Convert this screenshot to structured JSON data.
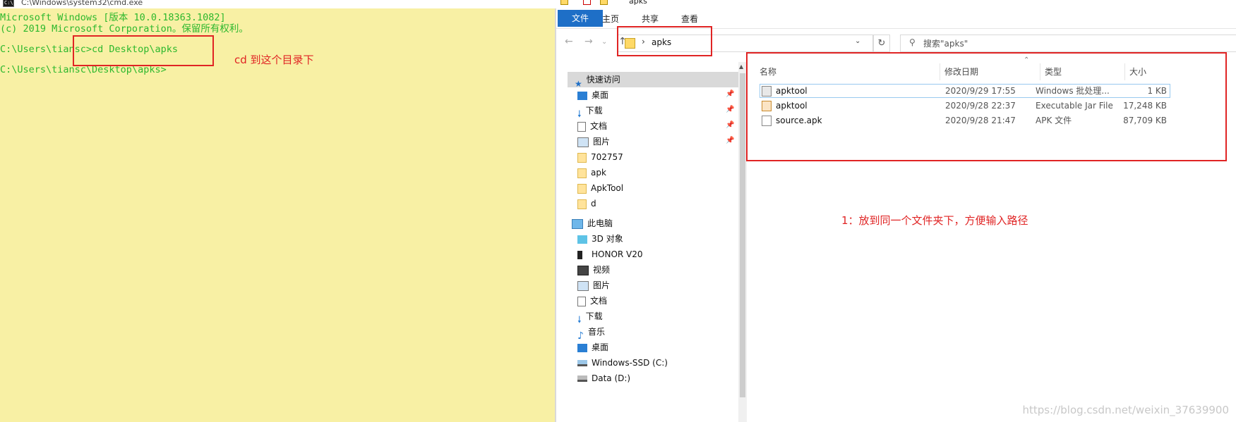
{
  "cmd": {
    "title": "C:\\Windows\\system32\\cmd.exe",
    "lines": [
      "Microsoft Windows [版本 10.0.18363.1082]",
      "(c) 2019 Microsoft Corporation。保留所有权利。",
      "",
      "C:\\Users\\tiansc>cd Desktop\\apks",
      "",
      "C:\\Users\\tiansc\\Desktop\\apks>"
    ],
    "text_color": "#2db82d",
    "background": "#f8f0a4"
  },
  "explorer": {
    "window_title": "apks",
    "ribbon_tabs": [
      "文件",
      "主页",
      "共享",
      "查看"
    ],
    "address": {
      "path": "apks",
      "separator": "›"
    },
    "search_placeholder": "搜索\"apks\"",
    "nav_buttons": {
      "back": "←",
      "forward": "→",
      "recent": "⌄",
      "up": "↑",
      "refresh": "↻"
    },
    "navpane": {
      "quick_access": "快速访问",
      "items": [
        {
          "label": "桌面",
          "icon": "desktop-icon",
          "pinned": true
        },
        {
          "label": "下载",
          "icon": "download-icon",
          "pinned": true
        },
        {
          "label": "文档",
          "icon": "document-icon",
          "pinned": true
        },
        {
          "label": "图片",
          "icon": "picture-icon",
          "pinned": true
        },
        {
          "label": "702757",
          "icon": "folder-icon",
          "pinned": false
        },
        {
          "label": "apk",
          "icon": "folder-icon",
          "pinned": false
        },
        {
          "label": "ApkTool",
          "icon": "folder-icon",
          "pinned": false
        },
        {
          "label": "d",
          "icon": "folder-icon",
          "pinned": false
        }
      ],
      "this_pc": "此电脑",
      "pc_items": [
        {
          "label": "3D 对象",
          "icon": "3d-objects-icon"
        },
        {
          "label": "HONOR V20",
          "icon": "phone-icon"
        },
        {
          "label": "视频",
          "icon": "video-icon"
        },
        {
          "label": "图片",
          "icon": "picture-icon"
        },
        {
          "label": "文档",
          "icon": "document-icon"
        },
        {
          "label": "下载",
          "icon": "download-icon"
        },
        {
          "label": "音乐",
          "icon": "music-icon"
        },
        {
          "label": "桌面",
          "icon": "desktop-icon"
        },
        {
          "label": "Windows-SSD (C:)",
          "icon": "drive-c-icon"
        },
        {
          "label": "Data (D:)",
          "icon": "drive-icon"
        }
      ]
    },
    "columns": [
      "名称",
      "修改日期",
      "类型",
      "大小"
    ],
    "files": [
      {
        "name": "apktool",
        "date": "2020/9/29 17:55",
        "type": "Windows 批处理...",
        "size": "1 KB",
        "icon": "batch-file-icon"
      },
      {
        "name": "apktool",
        "date": "2020/9/28 22:37",
        "type": "Executable Jar File",
        "size": "17,248 KB",
        "icon": "jar-file-icon"
      },
      {
        "name": "source.apk",
        "date": "2020/9/28 21:47",
        "type": "APK 文件",
        "size": "87,709 KB",
        "icon": "file-icon"
      }
    ],
    "accent": "#1e6fc7"
  },
  "annotations": {
    "cmd_note": "cd 到这个目录下",
    "files_note": "1：放到同一个文件夹下，方便输入路径",
    "color": "#e02424"
  },
  "watermark": "https://blog.csdn.net/weixin_37639900"
}
